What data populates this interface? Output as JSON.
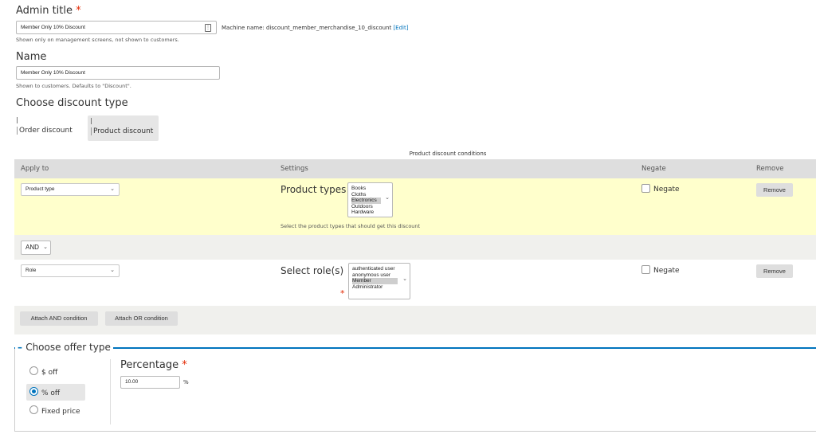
{
  "admin_title": {
    "label": "Admin title",
    "required_mark": "*",
    "value": "Member Only 10% Discount",
    "machine_name_label": "Machine name: discount_member_merchandise_10_discount",
    "edit_link": "[Edit]",
    "description": "Shown only on management screens, not shown to customers."
  },
  "name": {
    "label": "Name",
    "value": "Member Only 10% Discount",
    "description": "Shown to customers. Defaults to \"Discount\"."
  },
  "discount_type": {
    "label": "Choose discount type",
    "options": [
      "Order discount",
      "Product discount"
    ],
    "selected": "Product discount"
  },
  "conditions": {
    "caption": "Product discount conditions",
    "headers": [
      "Apply to",
      "Settings",
      "Negate",
      "Remove"
    ],
    "rows": [
      {
        "apply_to": "Product type",
        "settings_label": "Product types",
        "options": [
          "Books",
          "Cloths",
          "Electronics",
          "Outdoors",
          "Hardware"
        ],
        "selected": "Electronics",
        "help": "Select the product types that should get this discount",
        "negate_label": "Negate",
        "remove_label": "Remove"
      },
      {
        "apply_to": "Role",
        "settings_label": "Select role(s)",
        "options": [
          "authenticated user",
          "anonymous user",
          "Member",
          "Administrator"
        ],
        "selected": "Member",
        "required_mark": "*",
        "negate_label": "Negate",
        "remove_label": "Remove"
      }
    ],
    "operator": "AND",
    "attach_and": "Attach AND condition",
    "attach_or": "Attach OR condition"
  },
  "offer_type": {
    "legend": "Choose offer type",
    "options": [
      "$ off",
      "% off",
      "Fixed price"
    ],
    "selected": "% off",
    "percentage_label": "Percentage",
    "required_mark": "*",
    "percentage_value": "10.00",
    "percentage_suffix": "%"
  },
  "colors": {
    "accent": "#0074bd",
    "required": "#e32700",
    "row_highlight": "#ffffcc",
    "header_bg": "#dedede"
  }
}
